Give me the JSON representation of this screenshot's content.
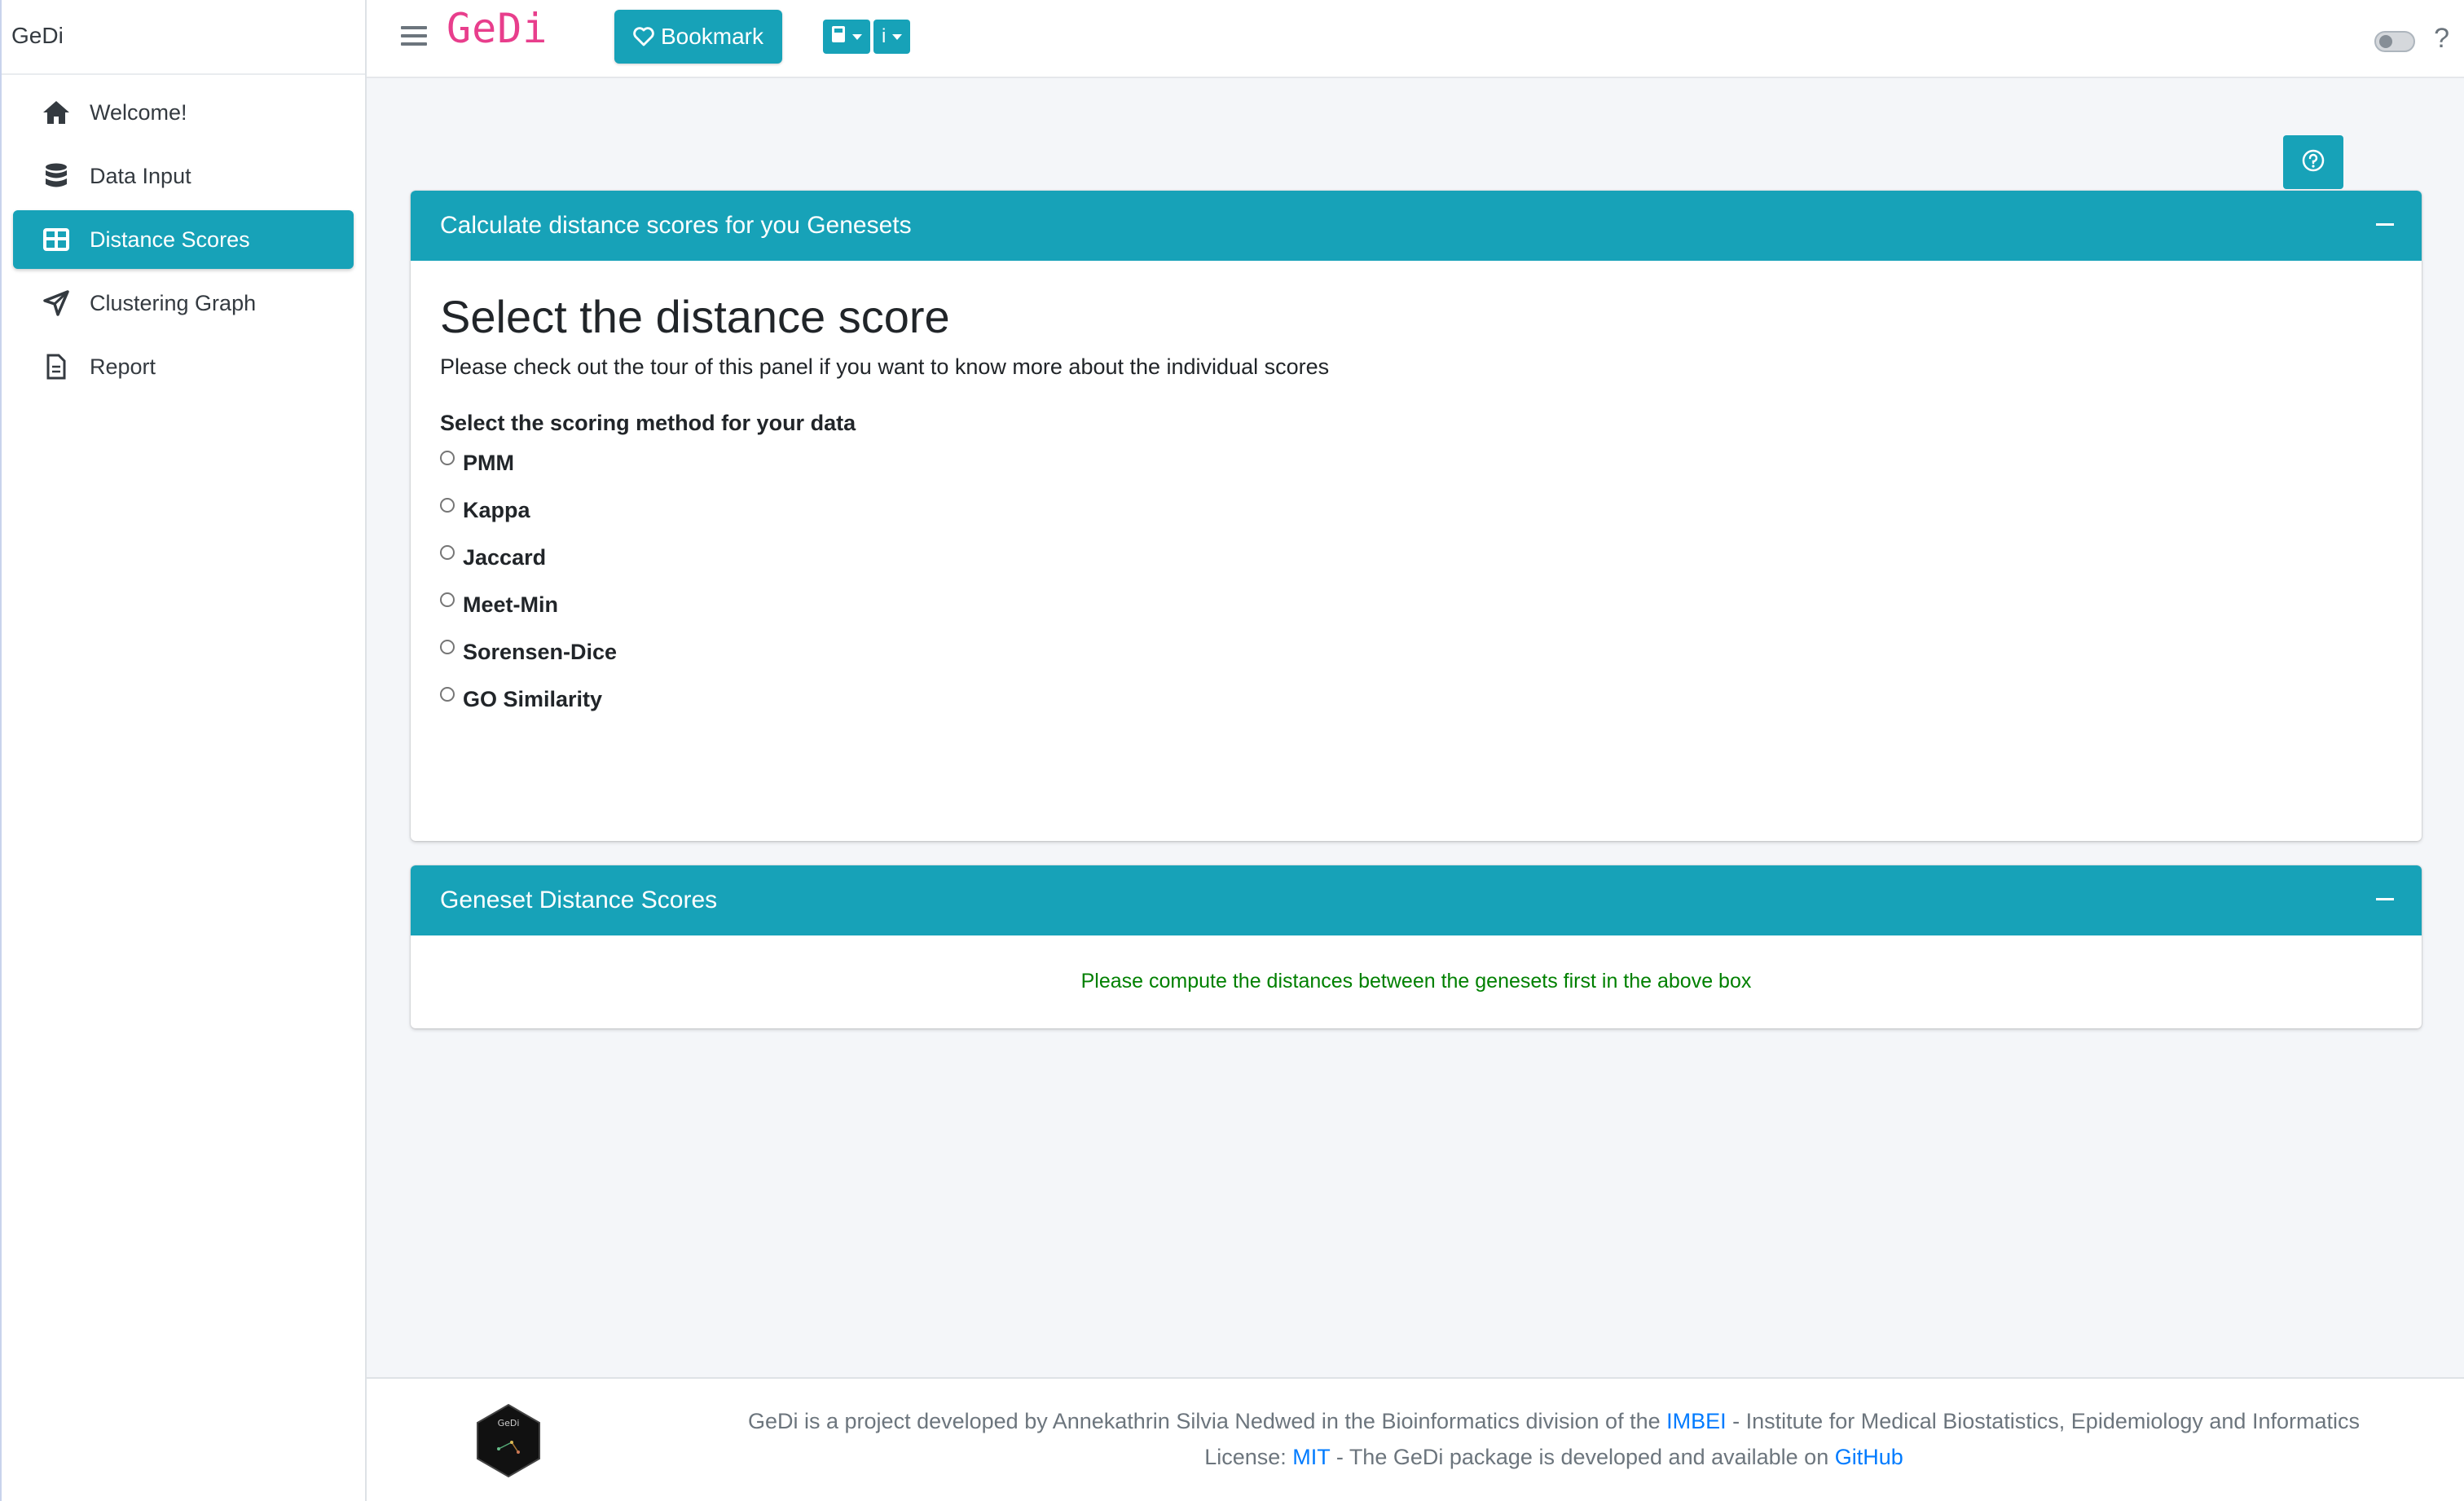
{
  "sidebar": {
    "brand": "GeDi",
    "items": [
      {
        "label": "Welcome!",
        "icon": "home-icon"
      },
      {
        "label": "Data Input",
        "icon": "database-icon"
      },
      {
        "label": "Distance Scores",
        "icon": "table-icon",
        "active": true
      },
      {
        "label": "Clustering Graph",
        "icon": "send-icon"
      },
      {
        "label": "Report",
        "icon": "document-icon"
      }
    ]
  },
  "header": {
    "app_title": "GeDi",
    "bookmark_label": "Bookmark",
    "info_label": "i",
    "help_label": "?"
  },
  "card1": {
    "header": "Calculate distance scores for you Genesets",
    "title": "Select the distance score",
    "subtitle": "Please check out the tour of this panel if you want to know more about the individual scores",
    "method_label": "Select the scoring method for your data",
    "options": [
      "PMM",
      "Kappa",
      "Jaccard",
      "Meet-Min",
      "Sorensen-Dice",
      "GO Similarity"
    ]
  },
  "card2": {
    "header": "Geneset Distance Scores",
    "message": "Please compute the distances between the genesets first in the above box"
  },
  "footer": {
    "logo_text": "GeDi",
    "line1_prefix": "GeDi is a project developed by Annekathrin Silvia Nedwed in the Bioinformatics division of the",
    "line1_link": "IMBEI",
    "line1_suffix": "- Institute for Medical Biostatistics, Epidemiology and Informatics",
    "line2_prefix": "License:",
    "line2_link1": "MIT",
    "line2_middle": "- The GeDi package is developed and available on",
    "line2_link2": "GitHub"
  },
  "colors": {
    "accent": "#17a2b8",
    "title_pink": "#e83e8c",
    "message_green": "#008000",
    "link_blue": "#007bff"
  }
}
